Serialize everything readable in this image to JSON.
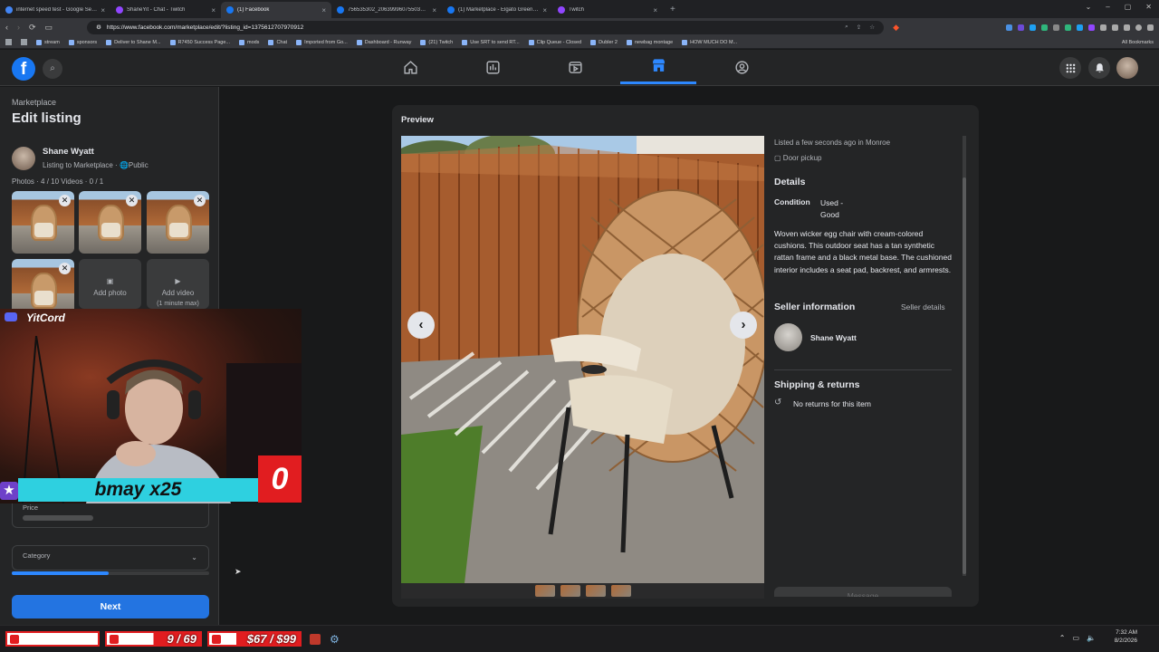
{
  "browser": {
    "tabs": [
      {
        "title": "internet speed test - Google Search",
        "color": "#4285f4",
        "active": false
      },
      {
        "title": "ShaneYit - Chat - Twitch",
        "color": "#9146ff",
        "active": false
      },
      {
        "title": "(1) Facebook",
        "color": "#1877f2",
        "active": true
      },
      {
        "title": "756535302_2063999607550370_675...",
        "color": "#1877f2",
        "active": false
      },
      {
        "title": "(1) Marketplace - Elgato Green Scree...",
        "color": "#1877f2",
        "active": false
      },
      {
        "title": "Twitch",
        "color": "#9146ff",
        "active": false
      }
    ],
    "url": "https://www.facebook.com/marketplace/edit/?listing_id=1375612707970912",
    "bookmarks": [
      "stream",
      "sponsors",
      "Deliver to Shane M...",
      "R7450 Success Page...",
      "mods",
      "Chat",
      "Imported from Go...",
      "Dashboard - Runway",
      "(21) Twitch",
      "Use SRT to send RT...",
      "Clip Queue - Closed",
      "Dubler 2",
      "newbag montage",
      "HOW MUCH DO M..."
    ],
    "all_bookmarks": "All Bookmarks"
  },
  "fb": {
    "logo": "f",
    "nav_icons": [
      "home-icon",
      "video-icon",
      "watch-icon",
      "marketplace-icon",
      "groups-icon"
    ],
    "active_nav": "marketplace-icon"
  },
  "left": {
    "breadcrumb": "Marketplace",
    "title": "Edit listing",
    "seller_name": "Shane Wyatt",
    "listing_sub": "Listing to Marketplace · ",
    "visibility": "Public",
    "photos_count": "Photos · 4 / 10 Videos · 0 / 1",
    "add_photo": "Add photo",
    "add_video": "Add video",
    "add_video_note": "(1 minute max)",
    "price_label": "Price",
    "category_label": "Category",
    "progress_percent": 49,
    "next_label": "Next"
  },
  "preview": {
    "title": "Preview",
    "listed_text": "Listed a few seconds ago in Monroe",
    "pickup": "Door pickup",
    "details_heading": "Details",
    "condition_label": "Condition",
    "condition_value": "Used - Good",
    "description": "Woven wicker egg chair with cream-colored cushions. This outdoor seat has a tan synthetic rattan frame and a black metal base. The cushioned interior includes a seat pad, backrest, and armrests.",
    "seller_heading": "Seller information",
    "seller_details": "Seller details",
    "seller_name": "Shane Wyatt",
    "shipping_heading": "Shipping & returns",
    "returns": "No returns for this item",
    "message_button": "Message"
  },
  "overlay": {
    "cam_label": "YitCord",
    "gifter": "bmay x25",
    "gift_count": "0",
    "goal1": "",
    "goal2": "9 / 69",
    "goal3": "$67 / $99"
  },
  "system": {
    "time": "7:32 AM",
    "date": "8/2/2026"
  }
}
